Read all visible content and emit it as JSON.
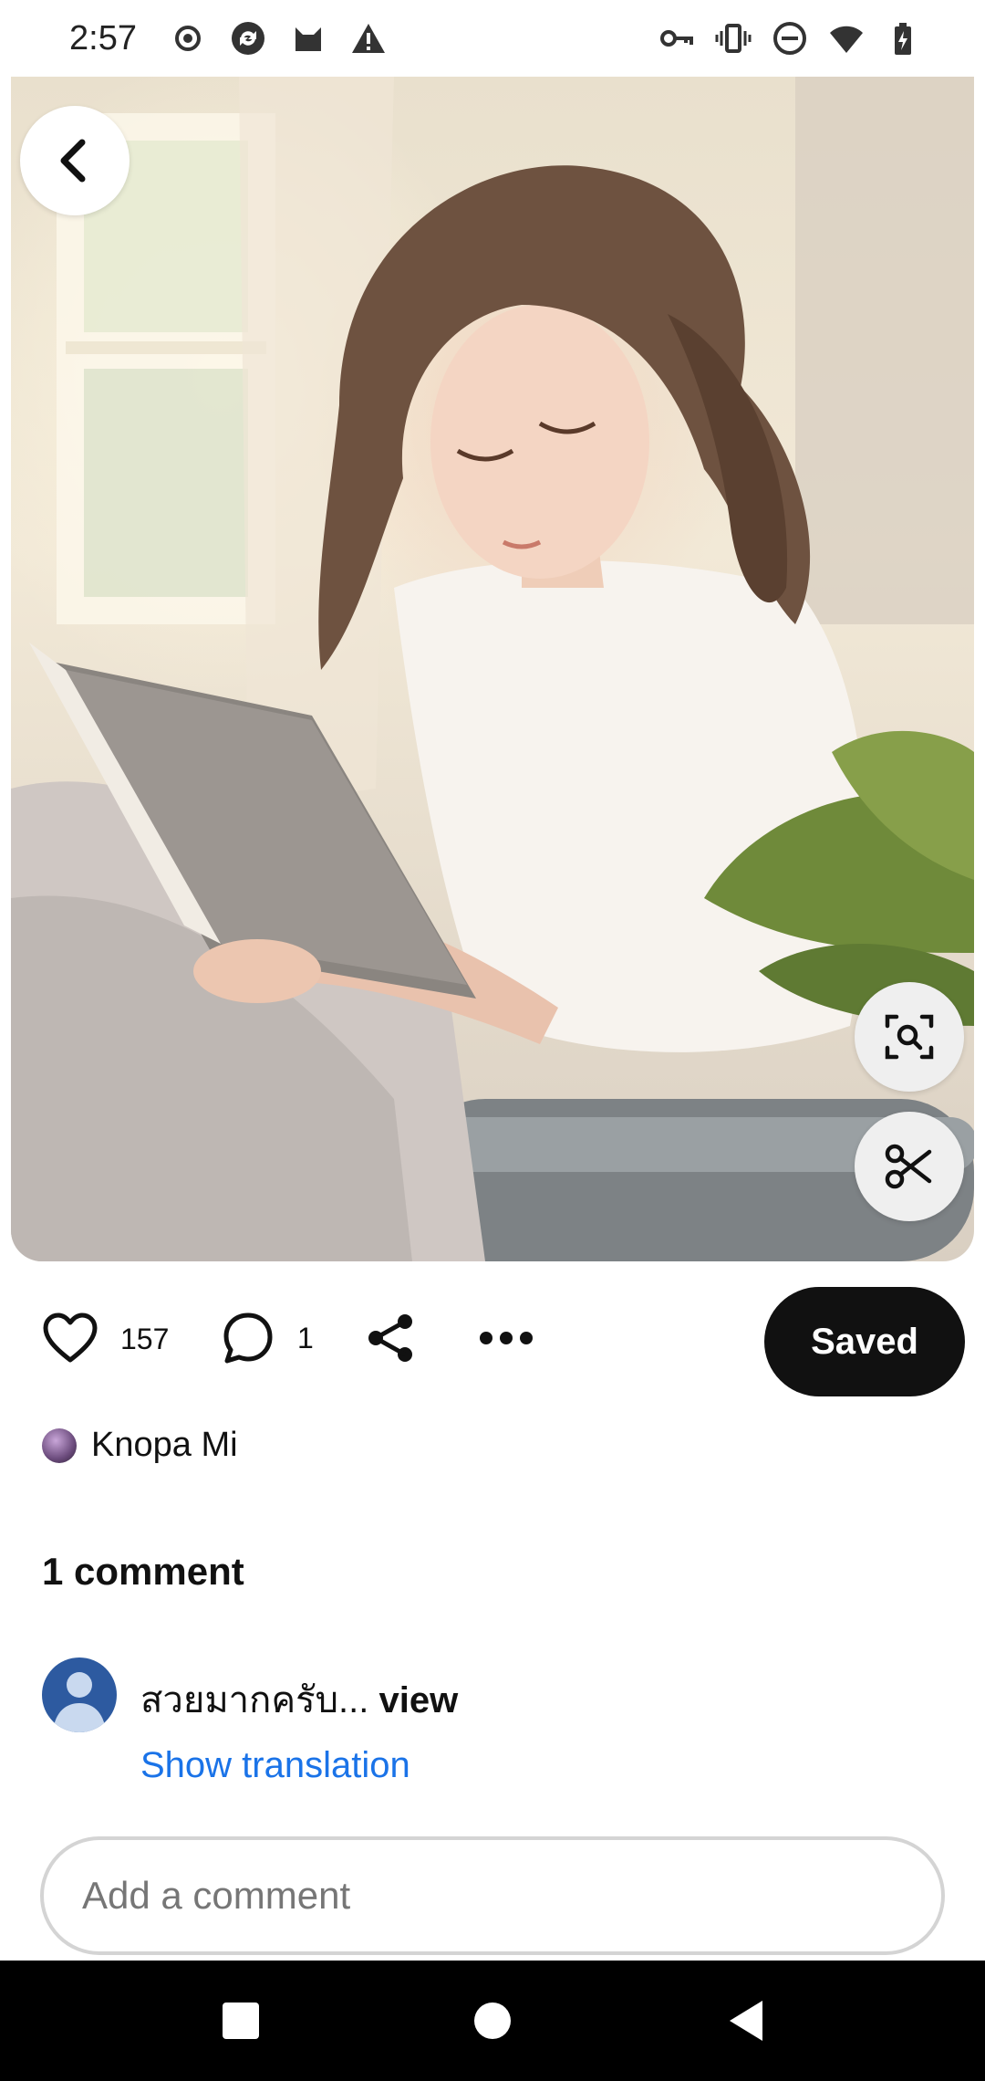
{
  "status_bar": {
    "time": "2:57",
    "left_icons": [
      "record-icon",
      "sync-icon",
      "cat-icon",
      "warning-icon"
    ],
    "right_icons": [
      "key-icon",
      "vibrate-icon",
      "dnd-icon",
      "wifi-icon",
      "battery-icon"
    ]
  },
  "hero": {
    "back_icon": "chevron-left-icon",
    "lens_icon": "visual-search-icon",
    "cut_icon": "scissors-icon"
  },
  "actions": {
    "like_count": "157",
    "comment_count": "1",
    "saved_label": "Saved"
  },
  "author": {
    "name": "Knopa Mi"
  },
  "comments": {
    "title": "1 comment",
    "items": [
      {
        "text": "สวยมากครับ...",
        "view_label": "view",
        "translate_label": "Show translation"
      }
    ]
  },
  "composer": {
    "placeholder": "Add a comment"
  },
  "colors": {
    "saved_bg": "#111111",
    "link": "#1a73e8",
    "avatar": "#2d5aa0"
  }
}
